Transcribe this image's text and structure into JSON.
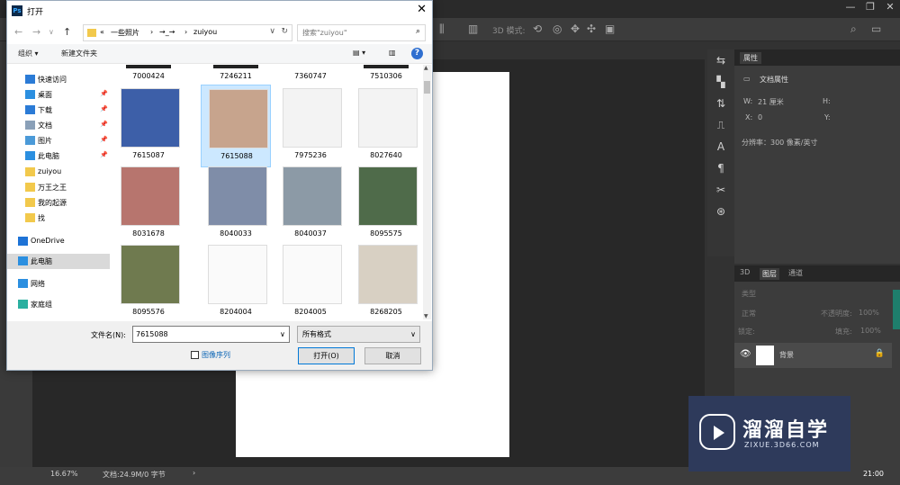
{
  "dialog": {
    "title": "打开",
    "app_badge": "Ps",
    "close_glyph": "✕",
    "nav": {
      "back_glyph": "←",
      "forward_glyph": "→",
      "recent_glyph": "∨",
      "up_glyph": "↑"
    },
    "address": {
      "prefix": "«",
      "segments": [
        "一些照片",
        "→_→",
        "zuiyou"
      ],
      "sep": "›",
      "dropdown": "∨",
      "refresh": "↻"
    },
    "search": {
      "placeholder": "搜索\"zuiyou\"",
      "icon": "⌕"
    },
    "toolbar": {
      "organize": "组织 ▾",
      "new_folder": "新建文件夹",
      "view_glyph": "▤ ▾",
      "pane_glyph": "▥",
      "help": "?"
    },
    "nav_pane": [
      {
        "label": "快速访问",
        "icon": "star-icon",
        "color": "#2b7bd6",
        "pinned": false
      },
      {
        "label": "桌面",
        "icon": "desktop-icon",
        "color": "#2b8fe0",
        "pinned": true
      },
      {
        "label": "下载",
        "icon": "download-icon",
        "color": "#2b7bd6",
        "pinned": true
      },
      {
        "label": "文档",
        "icon": "document-icon",
        "color": "#8aa0b8",
        "pinned": true
      },
      {
        "label": "图片",
        "icon": "pictures-icon",
        "color": "#4b9ad8",
        "pinned": true
      },
      {
        "label": "此电脑",
        "icon": "computer-icon",
        "color": "#2b8fe0",
        "pinned": true
      },
      {
        "label": "zuiyou",
        "icon": "folder-icon",
        "color": "#f2c94c",
        "pinned": false
      },
      {
        "label": "万王之王",
        "icon": "folder-icon",
        "color": "#f2c94c",
        "pinned": false
      },
      {
        "label": "我的起源",
        "icon": "folder-icon",
        "color": "#f2c94c",
        "pinned": false
      },
      {
        "label": "找",
        "icon": "folder-icon",
        "color": "#f2c94c",
        "pinned": false
      },
      {
        "label": "OneDrive",
        "icon": "onedrive-icon",
        "color": "#1e73d6",
        "pinned": false
      },
      {
        "label": "此电脑",
        "icon": "computer-icon",
        "color": "#2b8fe0",
        "pinned": false
      },
      {
        "label": "网络",
        "icon": "network-icon",
        "color": "#2b8fe0",
        "pinned": false
      },
      {
        "label": "家庭组",
        "icon": "homegroup-icon",
        "color": "#2bb0a0",
        "pinned": false
      }
    ],
    "pin_glyph": "📌",
    "files_partial_row": [
      "7000424",
      "7246211",
      "7360747",
      "7510306"
    ],
    "files": [
      {
        "name": "7615087",
        "color": "#3d5fa8"
      },
      {
        "name": "7615088",
        "color": "#c7a48d"
      },
      {
        "name": "7975236",
        "color": "#f3f3f3"
      },
      {
        "name": "8027640",
        "color": "#f3f3f3"
      },
      {
        "name": "8031678",
        "color": "#b7756e"
      },
      {
        "name": "8040033",
        "color": "#7f8da8"
      },
      {
        "name": "8040037",
        "color": "#8c9aa6"
      },
      {
        "name": "8095575",
        "color": "#4f6b4a"
      },
      {
        "name": "8095576",
        "color": "#6f7a4f"
      },
      {
        "name": "8204004",
        "color": "#fafafa"
      },
      {
        "name": "8204005",
        "color": "#fafafa"
      },
      {
        "name": "8268205",
        "color": "#d8d0c3"
      }
    ],
    "selected_file": "7615088",
    "filename_label": "文件名(N):",
    "filename_value": "7615088",
    "filename_dd": "∨",
    "filetype_value": "所有格式",
    "image_sequence_label": "图像序列",
    "open_button": "打开(O)",
    "cancel_button": "取消",
    "scroll_up": "▲",
    "scroll_down": "▼"
  },
  "photoshop": {
    "window_controls": [
      "—",
      "❐",
      "✕"
    ],
    "mode_label": "3D 模式:",
    "properties": {
      "tab": "属性",
      "doc_props": "文档属性",
      "w_label": "W:",
      "w_value": "21 厘米",
      "h_label": "H:",
      "x_label": "X:",
      "x_value": "0",
      "y_label": "Y:",
      "resolution": "分辨率：300 像素/英寸"
    },
    "layers": {
      "tabs": [
        "3D",
        "图层",
        "通道"
      ],
      "active_tab": "图层",
      "kind": "类型",
      "blend": "正常",
      "opacity_label": "不透明度:",
      "opacity_value": "100%",
      "lock_label": "锁定:",
      "fill_label": "填充:",
      "fill_value": "100%",
      "layer_name": "背景",
      "eye_glyph": "👁",
      "lock_glyph": "🔒"
    },
    "status": {
      "zoom": "16.67%",
      "doc": "文档:24.9M/0 字节",
      "arrow": "›",
      "clock": "21:00"
    },
    "side_tools": [
      "⇆",
      "▚",
      "⇅",
      "⎍",
      "A",
      "¶",
      "✂",
      "⊛"
    ]
  },
  "watermark": {
    "name": "溜溜自学",
    "url": "ZIXUE.3D66.COM"
  }
}
